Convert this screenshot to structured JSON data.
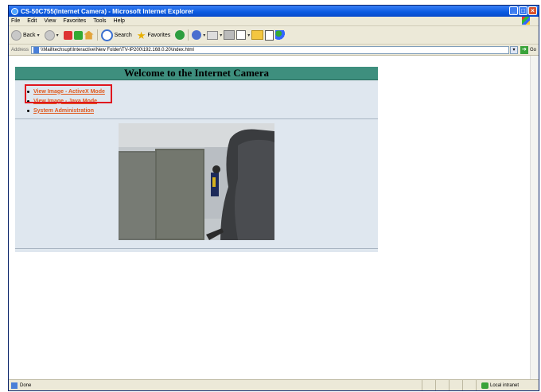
{
  "window": {
    "title": "CS-50C755(Internet Camera) - Microsoft Internet Explorer"
  },
  "menu": [
    "File",
    "Edit",
    "View",
    "Favorites",
    "Tools",
    "Help"
  ],
  "toolbar": {
    "back_label": "Back",
    "search_label": "Search",
    "favorites_label": "Favorites"
  },
  "address": {
    "label": "Address",
    "value": "\\\\Mail\\techsupt\\Interactive\\New Folder\\TV-IP200\\192.168.0.20\\index.html",
    "go_label": "Go"
  },
  "page": {
    "heading": "Welcome to the Internet Camera",
    "links": [
      {
        "label": "View Image - ActiveX Mode"
      },
      {
        "label": "View Image - Java Mode"
      },
      {
        "label": "System Administration"
      }
    ]
  },
  "status": {
    "text": "Done",
    "zone": "Local intranet"
  },
  "colors": {
    "heading_bg": "#3e8f7e",
    "panel_bg": "#dfe7ef",
    "link": "#e05a1e",
    "highlight_border": "#e0151e"
  }
}
